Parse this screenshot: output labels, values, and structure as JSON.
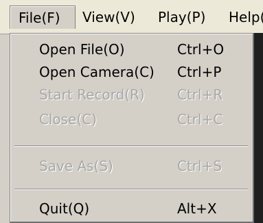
{
  "menubar": {
    "items": [
      {
        "label": "File(F)"
      },
      {
        "label": "View(V)"
      },
      {
        "label": "Play(P)"
      },
      {
        "label": "Help("
      }
    ]
  },
  "dropdown": {
    "items": [
      {
        "label": "Open File(O)",
        "shortcut": "Ctrl+O",
        "enabled": true
      },
      {
        "label": "Open Camera(C)",
        "shortcut": "Ctrl+P",
        "enabled": true
      },
      {
        "label": "Start Record(R)",
        "shortcut": "Ctrl+R",
        "enabled": false
      },
      {
        "label": "Close(C)",
        "shortcut": "Ctrl+C",
        "enabled": false
      },
      {
        "label": "Save As(S)",
        "shortcut": "Ctrl+S",
        "enabled": false
      },
      {
        "label": "Quit(Q)",
        "shortcut": "Alt+X",
        "enabled": true
      }
    ]
  }
}
